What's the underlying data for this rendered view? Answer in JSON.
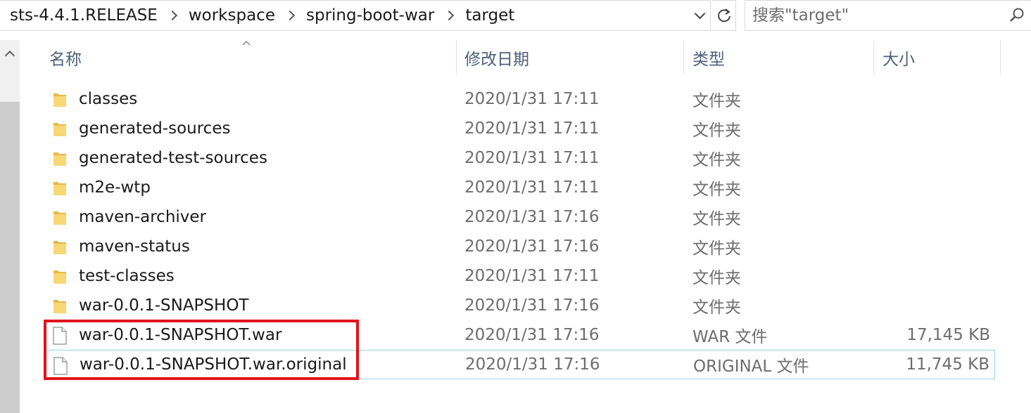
{
  "address_bar": {
    "crumbs": [
      "sts-4.4.1.RELEASE",
      "workspace",
      "spring-boot-war",
      "target"
    ]
  },
  "search": {
    "placeholder": "搜索\"target\""
  },
  "columns": {
    "name": "名称",
    "date": "修改日期",
    "type": "类型",
    "size": "大小"
  },
  "files": [
    {
      "name": "classes",
      "date": "2020/1/31 17:11",
      "type": "文件夹",
      "size": "",
      "icon": "folder-icon"
    },
    {
      "name": "generated-sources",
      "date": "2020/1/31 17:11",
      "type": "文件夹",
      "size": "",
      "icon": "folder-icon"
    },
    {
      "name": "generated-test-sources",
      "date": "2020/1/31 17:11",
      "type": "文件夹",
      "size": "",
      "icon": "folder-icon"
    },
    {
      "name": "m2e-wtp",
      "date": "2020/1/31 17:11",
      "type": "文件夹",
      "size": "",
      "icon": "folder-icon"
    },
    {
      "name": "maven-archiver",
      "date": "2020/1/31 17:16",
      "type": "文件夹",
      "size": "",
      "icon": "folder-icon"
    },
    {
      "name": "maven-status",
      "date": "2020/1/31 17:16",
      "type": "文件夹",
      "size": "",
      "icon": "folder-icon"
    },
    {
      "name": "test-classes",
      "date": "2020/1/31 17:11",
      "type": "文件夹",
      "size": "",
      "icon": "folder-icon"
    },
    {
      "name": "war-0.0.1-SNAPSHOT",
      "date": "2020/1/31 17:16",
      "type": "文件夹",
      "size": "",
      "icon": "folder-icon"
    },
    {
      "name": "war-0.0.1-SNAPSHOT.war",
      "date": "2020/1/31 17:16",
      "type": "WAR 文件",
      "size": "17,145 KB",
      "icon": "file-icon"
    },
    {
      "name": "war-0.0.1-SNAPSHOT.war.original",
      "date": "2020/1/31 17:16",
      "type": "ORIGINAL 文件",
      "size": "11,745 KB",
      "icon": "file-icon"
    }
  ],
  "colors": {
    "folder": "#f8d775",
    "header_text": "#4c607a",
    "highlight": "#e0141e",
    "focus_border": "#99d1e3"
  }
}
